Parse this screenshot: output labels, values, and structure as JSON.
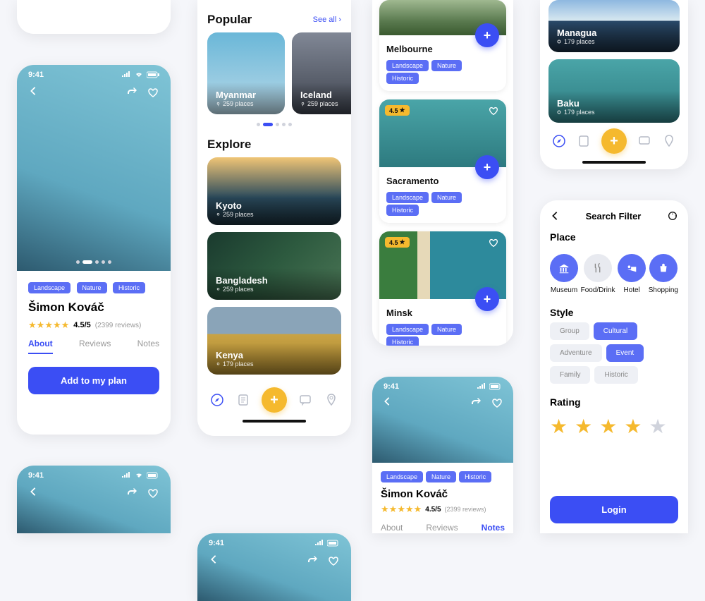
{
  "status_time": "9:41",
  "colors": {
    "primary": "#3b4ef4",
    "accent": "#f5b92e",
    "tag": "#5b6ef5"
  },
  "detail": {
    "tags": [
      "Landscape",
      "Nature",
      "Historic"
    ],
    "name": "Šimon Kováč",
    "rating_value": "4.5/5",
    "reviews_count": "(2399 reviews)",
    "tabs": [
      "About",
      "Reviews",
      "Notes"
    ],
    "add_button": "Add to my plan"
  },
  "discover": {
    "popular_title": "Popular",
    "see_all": "See all",
    "popular": [
      {
        "name": "Myanmar",
        "places": "259 places"
      },
      {
        "name": "Iceland",
        "places": "259 places"
      }
    ],
    "explore_title": "Explore",
    "explore": [
      {
        "name": "Kyoto",
        "places": "259 places"
      },
      {
        "name": "Bangladesh",
        "places": "259 places"
      },
      {
        "name": "Kenya",
        "places": "179 places"
      }
    ]
  },
  "feed": {
    "cards": [
      {
        "name": "Melbourne",
        "rating": null,
        "tags": [
          "Landscape",
          "Nature",
          "Historic"
        ]
      },
      {
        "name": "Sacramento",
        "rating": "4.5",
        "tags": [
          "Landscape",
          "Nature",
          "Historic"
        ]
      },
      {
        "name": "Minsk",
        "rating": "4.5",
        "tags": [
          "Landscape",
          "Nature",
          "Historic"
        ]
      }
    ]
  },
  "places": {
    "items": [
      {
        "name": "Managua",
        "places": "179 places"
      },
      {
        "name": "Baku",
        "places": "179 places"
      }
    ]
  },
  "filter": {
    "title": "Search Filter",
    "place_label": "Place",
    "place_items": [
      {
        "label": "Museum",
        "selected": true
      },
      {
        "label": "Food/Drink",
        "selected": false
      },
      {
        "label": "Hotel",
        "selected": true
      },
      {
        "label": "Shopping",
        "selected": true
      }
    ],
    "style_label": "Style",
    "style_items": [
      {
        "label": "Group",
        "selected": false
      },
      {
        "label": "Cultural",
        "selected": true
      },
      {
        "label": "Adventure",
        "selected": false
      },
      {
        "label": "Event",
        "selected": true
      },
      {
        "label": "Family",
        "selected": false
      },
      {
        "label": "Historic",
        "selected": false
      }
    ],
    "rating_label": "Rating",
    "rating_value": 4,
    "login_button": "Login"
  }
}
